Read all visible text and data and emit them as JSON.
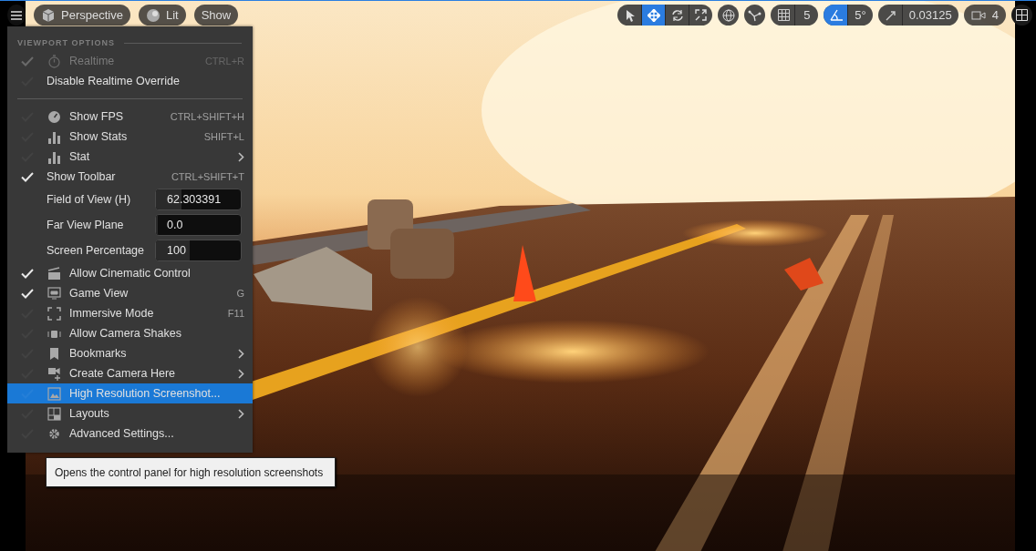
{
  "top_left_toolbar": {
    "buttons": [
      {
        "label": "Perspective"
      },
      {
        "label": "Lit"
      },
      {
        "label": "Show"
      }
    ]
  },
  "top_right_toolbar": {
    "transform_tools": [
      {
        "selected": false
      },
      {
        "selected": true
      },
      {
        "selected": false
      },
      {
        "selected": false
      }
    ],
    "grid_snap": {
      "value": "5",
      "on": false
    },
    "rotation_snap": {
      "value": "5°",
      "on": true
    },
    "scale_snap": {
      "value": "0.03125",
      "on": false
    },
    "camera_speed": {
      "value": "4"
    }
  },
  "viewport_options_menu": {
    "title": "VIEWPORT OPTIONS",
    "items": [
      {
        "kind": "item",
        "label": "Realtime",
        "checked": true,
        "disabled": true,
        "selected": false,
        "submenu": false,
        "shortcut": "CTRL+R"
      },
      {
        "kind": "item",
        "label": "Disable Realtime Override",
        "checked": false,
        "disabled": false,
        "selected": false,
        "submenu": false
      },
      {
        "kind": "separator"
      },
      {
        "kind": "item",
        "label": "Show FPS",
        "checked": false,
        "disabled": false,
        "selected": false,
        "submenu": false,
        "shortcut": "CTRL+SHIFT+H"
      },
      {
        "kind": "item",
        "label": "Show Stats",
        "checked": false,
        "disabled": false,
        "selected": false,
        "submenu": false,
        "shortcut": "SHIFT+L"
      },
      {
        "kind": "item",
        "label": "Stat",
        "checked": false,
        "disabled": false,
        "selected": false,
        "submenu": true
      },
      {
        "kind": "item",
        "label": "Show Toolbar",
        "checked": true,
        "disabled": false,
        "selected": false,
        "submenu": false,
        "shortcut": "CTRL+SHIFT+T"
      },
      {
        "kind": "field",
        "label": "Field of View (H)",
        "value": "62.303391",
        "level": 0.3
      },
      {
        "kind": "field",
        "label": "Far View Plane",
        "value": "0.0",
        "level": 0
      },
      {
        "kind": "field",
        "label": "Screen Percentage",
        "value": "100",
        "level": 0.4
      },
      {
        "kind": "item",
        "label": "Allow Cinematic Control",
        "checked": true,
        "disabled": false,
        "selected": false,
        "submenu": false
      },
      {
        "kind": "item",
        "label": "Game View",
        "checked": true,
        "disabled": false,
        "selected": false,
        "submenu": false,
        "shortcut": "G"
      },
      {
        "kind": "item",
        "label": "Immersive Mode",
        "checked": false,
        "disabled": false,
        "selected": false,
        "submenu": false,
        "shortcut": "F11"
      },
      {
        "kind": "item",
        "label": "Allow Camera Shakes",
        "checked": false,
        "disabled": false,
        "selected": false,
        "submenu": false
      },
      {
        "kind": "item",
        "label": "Bookmarks",
        "checked": false,
        "disabled": false,
        "selected": false,
        "submenu": true
      },
      {
        "kind": "item",
        "label": "Create Camera Here",
        "checked": false,
        "disabled": false,
        "selected": false,
        "submenu": true
      },
      {
        "kind": "item",
        "label": "High Resolution Screenshot...",
        "checked": false,
        "disabled": false,
        "selected": true,
        "submenu": false
      },
      {
        "kind": "item",
        "label": "Layouts",
        "checked": false,
        "disabled": false,
        "selected": false,
        "submenu": true
      },
      {
        "kind": "item",
        "label": "Advanced Settings...",
        "checked": false,
        "disabled": false,
        "selected": false,
        "submenu": false
      }
    ]
  },
  "tooltip": {
    "text": "Opens the control panel for high resolution screenshots"
  }
}
